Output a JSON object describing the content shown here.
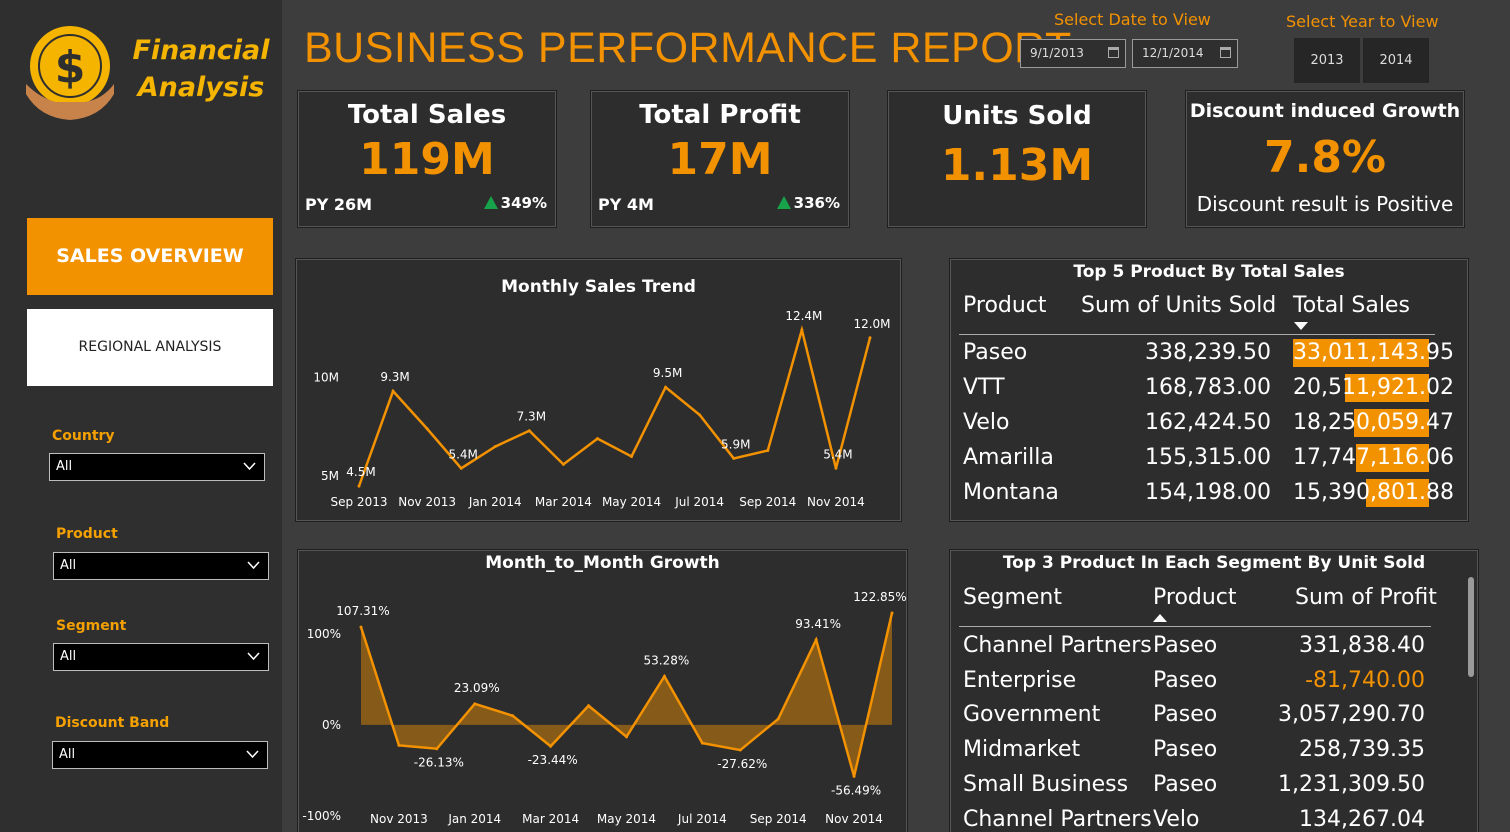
{
  "logo": {
    "line1": "Financial",
    "line2": "Analysis",
    "icon": "dollar-coin-hand-icon"
  },
  "nav": {
    "sales_overview": "SALES OVERVIEW",
    "regional_analysis": "REGIONAL ANALYSIS"
  },
  "filters": [
    {
      "label": "Country",
      "value": "All"
    },
    {
      "label": "Product",
      "value": "All"
    },
    {
      "label": "Segment",
      "value": "All"
    },
    {
      "label": "Discount Band",
      "value": "All"
    }
  ],
  "title": "BUSINESS PERFORMANCE REPORT",
  "date_picker": {
    "label": "Select Date to View",
    "start": "9/1/2013",
    "end": "12/1/2014"
  },
  "year_picker": {
    "label": "Select Year to View",
    "years": [
      "2013",
      "2014"
    ]
  },
  "kpis": {
    "sales": {
      "title": "Total Sales",
      "value": "119M",
      "py": "PY 26M",
      "growth": "349%"
    },
    "profit": {
      "title": "Total Profit",
      "value": "17M",
      "py": "PY  4M",
      "growth": "336%"
    },
    "units": {
      "title": "Units Sold",
      "value": "1.13M"
    },
    "discount": {
      "title": "Discount induced Growth",
      "value": "7.8%",
      "note": "Discount result is Positive"
    }
  },
  "colors": {
    "accent": "#f39200",
    "background": "#3d3d3d",
    "panel": "#2d2d2d",
    "positive": "#16a34a",
    "negative": "#f39200"
  },
  "chart_data": [
    {
      "type": "line",
      "title": "Monthly Sales Trend",
      "x": [
        "Sep 2013",
        "Oct 2013",
        "Nov 2013",
        "Dec 2013",
        "Jan 2014",
        "Feb 2014",
        "Mar 2014",
        "Apr 2014",
        "May 2014",
        "Jun 2014",
        "Jul 2014",
        "Aug 2014",
        "Sep 2014",
        "Oct 2014",
        "Nov 2014",
        "Dec 2014"
      ],
      "x_tick_labels": [
        "Sep 2013",
        "Nov 2013",
        "Jan 2014",
        "Mar 2014",
        "May 2014",
        "Jul 2014",
        "Sep 2014",
        "Nov 2014"
      ],
      "values": [
        4.5,
        9.3,
        7.4,
        5.4,
        6.5,
        7.3,
        5.6,
        6.9,
        6.0,
        9.5,
        8.1,
        5.9,
        6.3,
        12.4,
        5.4,
        12.0
      ],
      "data_labels": {
        "0": "4.5M",
        "1": "9.3M",
        "3": "5.4M",
        "5": "7.3M",
        "9": "9.5M",
        "11": "5.9M",
        "13": "12.4M",
        "14": "5.4M",
        "15": "12.0M"
      },
      "y_tick_labels": [
        "5M",
        "10M"
      ],
      "y_ticks": [
        5,
        10
      ],
      "ylim": [
        4,
        13
      ]
    },
    {
      "type": "area",
      "title": "Month_to_Month Growth",
      "x": [
        "Oct 2013",
        "Nov 2013",
        "Dec 2013",
        "Jan 2014",
        "Feb 2014",
        "Mar 2014",
        "Apr 2014",
        "May 2014",
        "Jun 2014",
        "Jul 2014",
        "Aug 2014",
        "Sep 2014",
        "Oct 2014",
        "Nov 2014",
        "Dec 2014"
      ],
      "x_tick_labels": [
        "Nov 2013",
        "Jan 2014",
        "Mar 2014",
        "May 2014",
        "Jul 2014",
        "Sep 2014",
        "Nov 2014"
      ],
      "values": [
        107.31,
        -22.5,
        -26.13,
        23.09,
        10.0,
        -23.44,
        21.0,
        -13.0,
        53.28,
        -20.0,
        -27.62,
        6.5,
        93.41,
        -56.49,
        122.85
      ],
      "data_labels": {
        "0": "107.31%",
        "2": "-26.13%",
        "3": "23.09%",
        "5": "-23.44%",
        "8": "53.28%",
        "10": "-27.62%",
        "12": "93.41%",
        "13": "-56.49%",
        "14": "122.85%"
      },
      "y_tick_labels": [
        "100%",
        "0%",
        "-100%"
      ],
      "y_ticks": [
        100,
        0,
        -100
      ],
      "ylim": [
        -100,
        125
      ]
    }
  ],
  "top5": {
    "title": "Top 5 Product By Total Sales",
    "columns": [
      "Product",
      "Sum of Units Sold",
      "Total Sales"
    ],
    "rows": [
      {
        "product": "Paseo",
        "units": "338,239.50",
        "sales": "33,011,143.95",
        "sales_value": 33011143.95
      },
      {
        "product": "VTT",
        "units": "168,783.00",
        "sales": "20,511,921.02",
        "sales_value": 20511921.02
      },
      {
        "product": "Velo",
        "units": "162,424.50",
        "sales": "18,250,059.47",
        "sales_value": 18250059.47
      },
      {
        "product": "Amarilla",
        "units": "155,315.00",
        "sales": "17,747,116.06",
        "sales_value": 17747116.06
      },
      {
        "product": "Montana",
        "units": "154,198.00",
        "sales": "15,390,801.88",
        "sales_value": 15390801.88
      }
    ]
  },
  "top3": {
    "title": "Top 3 Product In Each Segment By Unit Sold",
    "columns": [
      "Segment",
      "Product",
      "Sum of Profit"
    ],
    "rows": [
      {
        "segment": "Channel Partners",
        "product": "Paseo",
        "profit": "331,838.40",
        "negative": false
      },
      {
        "segment": "Enterprise",
        "product": "Paseo",
        "profit": "-81,740.00",
        "negative": true
      },
      {
        "segment": "Government",
        "product": "Paseo",
        "profit": "3,057,290.70",
        "negative": false
      },
      {
        "segment": "Midmarket",
        "product": "Paseo",
        "profit": "258,739.35",
        "negative": false
      },
      {
        "segment": "Small Business",
        "product": "Paseo",
        "profit": "1,231,309.50",
        "negative": false
      },
      {
        "segment": "Channel Partners",
        "product": "Velo",
        "profit": "134,267.04",
        "negative": false
      }
    ]
  }
}
